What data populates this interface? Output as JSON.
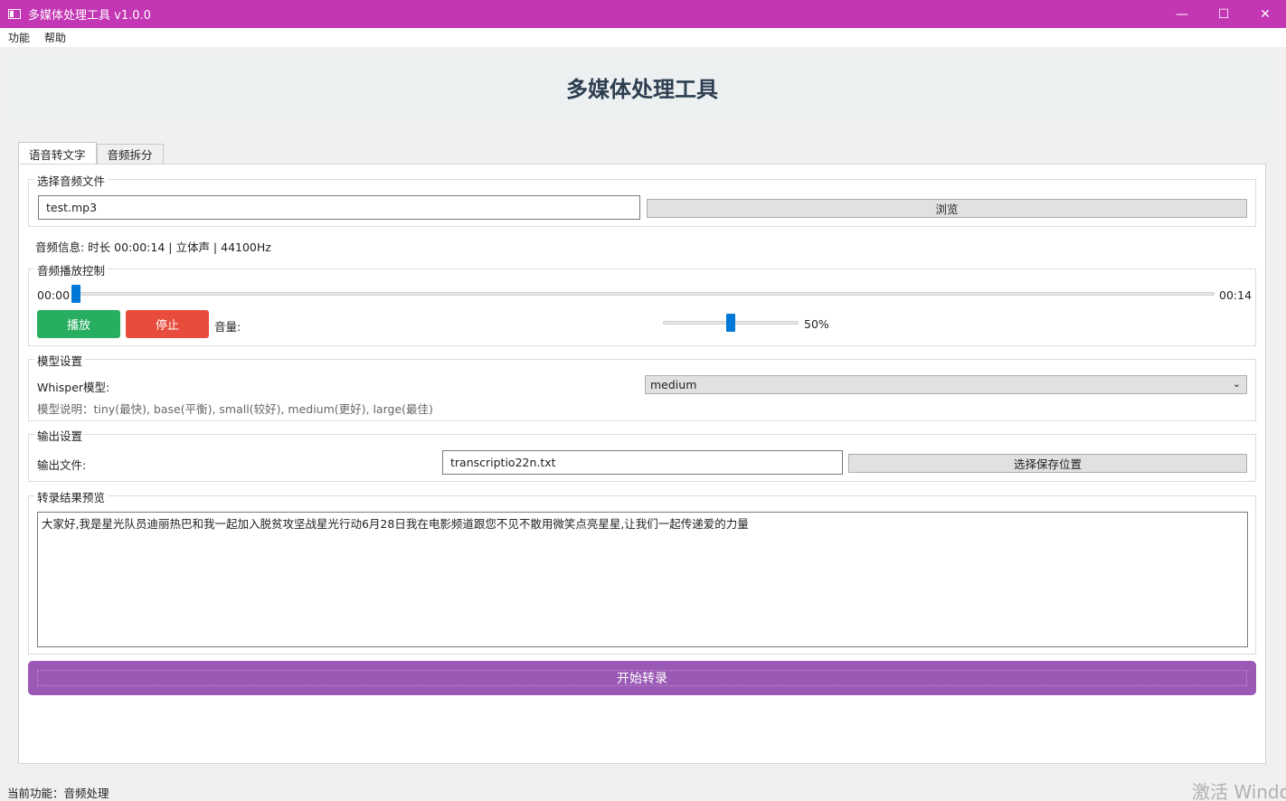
{
  "window": {
    "title": "多媒体处理工具 v1.0.0",
    "minimize": "—",
    "maximize": "☐",
    "close": "✕"
  },
  "menu": [
    "功能",
    "帮助"
  ],
  "header": {
    "title": "多媒体处理工具"
  },
  "tabs": [
    "语音转文字",
    "音频拆分"
  ],
  "file_group": {
    "title": "选择音频文件",
    "file_value": "test.mp3",
    "browse_label": "浏览"
  },
  "audio_info": "音频信息: 时长 00:00:14 | 立体声 | 44100Hz",
  "playback": {
    "title": "音频播放控制",
    "current_time": "00:00",
    "total_time": "00:14",
    "progress": 0.0,
    "play_label": "播放",
    "stop_label": "停止",
    "volume_label": "音量:",
    "volume_value": "50%",
    "volume_level": 0.5
  },
  "model": {
    "title": "模型设置",
    "label": "Whisper模型:",
    "selected": "medium",
    "description": "模型说明：tiny(最快), base(平衡), small(较好), medium(更好), large(最佳)"
  },
  "output": {
    "title": "输出设置",
    "label": "输出文件:",
    "file_value": "transcriptio22n.txt",
    "choose_label": "选择保存位置"
  },
  "preview": {
    "title": "转录结果预览",
    "text": "大家好,我是星光队员迪丽热巴和我一起加入脱贫攻坚战星光行动6月28日我在电影频道跟您不见不散用微笑点亮星星,让我们一起传递爱的力量"
  },
  "start_label": "开始转录",
  "status": "当前功能：音频处理",
  "watermark": "激活 Windows",
  "colors": {
    "titlebar": "#c336b4",
    "play": "#27ae60",
    "stop": "#e74c3c",
    "start": "#9b59b6",
    "slider": "#0078d7"
  }
}
